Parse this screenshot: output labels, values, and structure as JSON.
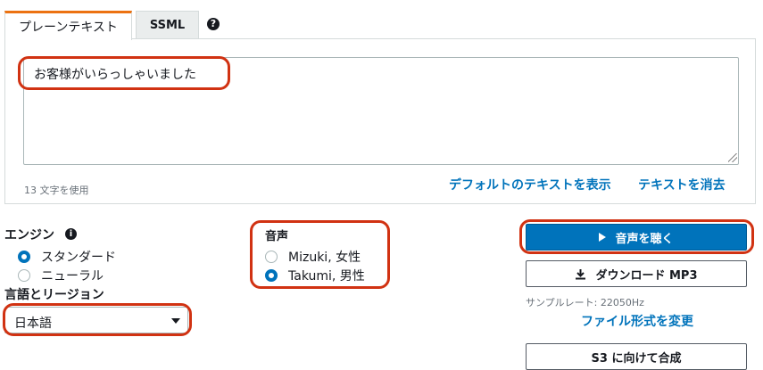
{
  "tabs": {
    "plain_text": "プレーンテキスト",
    "ssml": "SSML",
    "help": "?"
  },
  "editor": {
    "text": "お客様がいらっしゃいました",
    "char_count": "13 文字を使用",
    "link_default": "デフォルトのテキストを表示",
    "link_clear": "テキストを消去"
  },
  "engine": {
    "label": "エンジン",
    "info": "i",
    "options": [
      "スタンダード",
      "ニューラル"
    ],
    "selected": "スタンダード"
  },
  "region": {
    "label": "言語とリージョン",
    "selected": "日本語"
  },
  "voice": {
    "label": "音声",
    "options": [
      "Mizuki, 女性",
      "Takumi, 男性"
    ],
    "selected": "Takumi, 男性"
  },
  "actions": {
    "listen": "音声を聴く",
    "download": "ダウンロード MP3",
    "sample_rate": "サンプルレート: 22050Hz",
    "change_format": "ファイル形式を変更",
    "s3": "S3 に向けて合成"
  },
  "colors": {
    "accent_tab": "#ec7211",
    "primary": "#0073bb",
    "highlight": "#d13212"
  }
}
